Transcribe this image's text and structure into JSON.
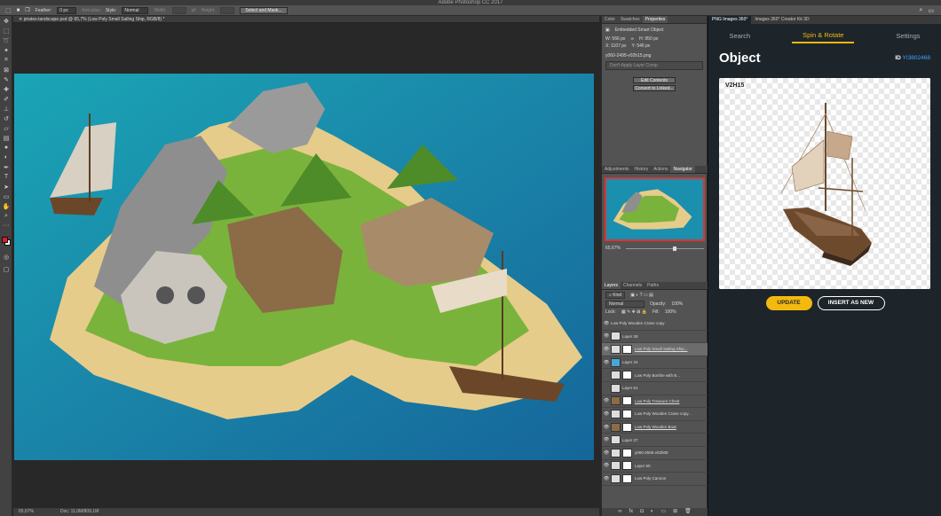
{
  "app": {
    "title": "Adobe Photoshop CC 2017"
  },
  "options_bar": {
    "feather_label": "Feather:",
    "feather_value": "0 px",
    "anti_alias_label": "Anti-alias",
    "style_label": "Style:",
    "style_value": "Normal",
    "width_label": "Width:",
    "height_label": "Height:",
    "select_mask_label": "Select and Mask..."
  },
  "document": {
    "tab_title": "pirates-landscape.psd @ 65,7% (Low Poly Small Sailing Ship, RGB/8) *",
    "zoom": "65,67%",
    "doc_info": "Doc: 11,0M/809,1M"
  },
  "panel_top": {
    "tabs": [
      "Color",
      "Swatches",
      "Properties"
    ],
    "active_tab": "Properties",
    "object_type": "Embedded Smart Object",
    "w_label": "W:",
    "w_value": "566 px",
    "h_label": "H:",
    "h_value": "950 px",
    "x_label": "X:",
    "x_value": "1107 px",
    "y_label": "Y:",
    "y_value": "546 px",
    "filename": "y060-2495-v02h15.png",
    "layer_comp_placeholder": "Don't Apply Layer Comp",
    "edit_contents": "Edit Contents",
    "convert_linked": "Convert to Linked..."
  },
  "panel_mid": {
    "tabs": [
      "Adjustments",
      "History",
      "Actions",
      "Navigator"
    ],
    "active_tab": "Navigator",
    "zoom": "65,67%"
  },
  "layers_panel": {
    "tabs": [
      "Layers",
      "Channels",
      "Paths"
    ],
    "active_tab": "Layers",
    "kind_label": "Kind",
    "blend_mode": "Normal",
    "opacity_label": "Opacity:",
    "opacity_value": "100%",
    "lock_label": "Lock:",
    "fill_label": "Fill:",
    "fill_value": "100%",
    "layers": [
      {
        "name": "Low Poly Wooden Crane copy"
      },
      {
        "name": "Layer 28"
      },
      {
        "name": "Low Poly Small Sailing Ship..."
      },
      {
        "name": "Layer 24"
      },
      {
        "name": "Low Poly Bonfire with B..."
      },
      {
        "name": "Layer 61"
      },
      {
        "name": "Low Poly Treasure Chest"
      },
      {
        "name": "Low Poly Wooden Crane copy..."
      },
      {
        "name": "Low Poly Wooden Boat"
      },
      {
        "name": "Layer 27"
      },
      {
        "name": "y060-2505-v02h08"
      },
      {
        "name": "Layer 60"
      },
      {
        "name": "Low Poly Cannon"
      }
    ]
  },
  "plugin": {
    "window_tabs": [
      "PNG Images 360°",
      "Images 360° Creator Kit 3D"
    ],
    "nav": [
      "Search",
      "Spin & Rotate",
      "Settings"
    ],
    "active_nav": "Spin & Rotate",
    "heading": "Object",
    "id_label": "ID",
    "id_value": "YI3802468",
    "preview_label": "V2H15",
    "update_button": "UPDATE",
    "insert_button": "INSERT AS NEW"
  },
  "colors": {
    "accent": "#f3b90f",
    "link": "#3fa6ff",
    "plugin_bg": "#1d252b"
  }
}
